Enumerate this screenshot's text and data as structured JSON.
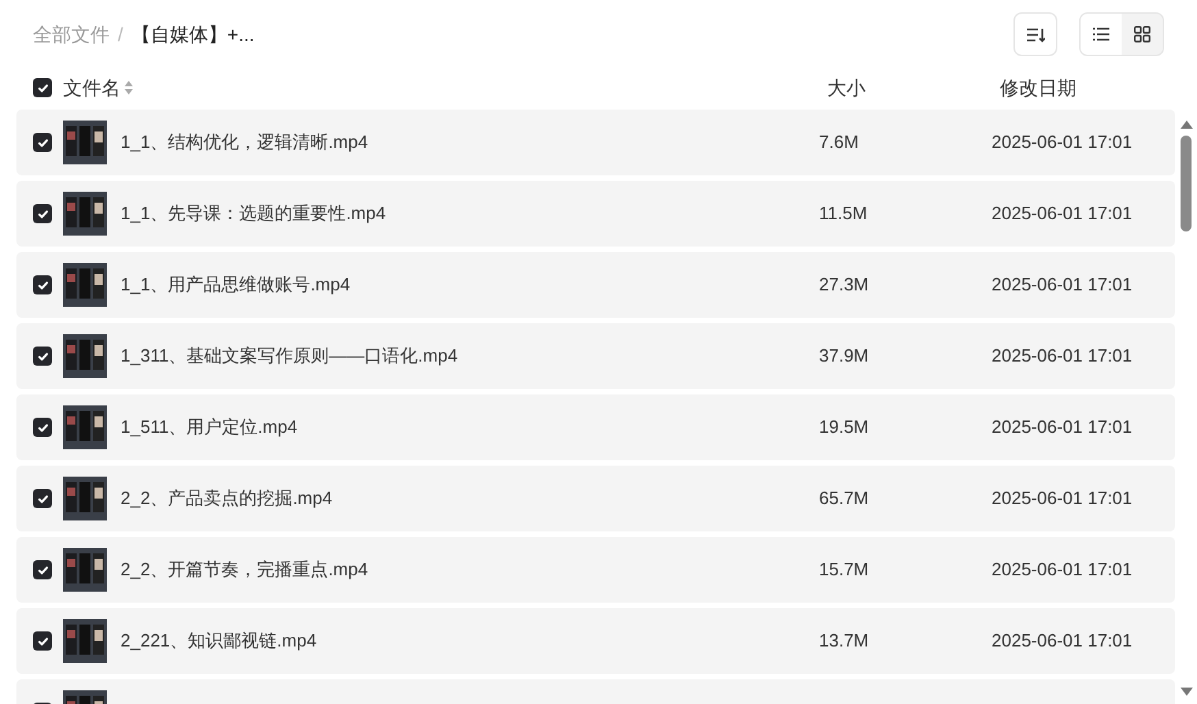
{
  "breadcrumb": [
    {
      "label": "全部文件",
      "current": false
    },
    {
      "label": "【自媒体】+...",
      "current": true
    }
  ],
  "breadcrumb_separator": "/",
  "view_toggle": [
    {
      "kind": "list",
      "selected": true
    },
    {
      "kind": "grid",
      "selected": false
    }
  ],
  "header": {
    "checked": true,
    "columns": [
      "文件名",
      "大小",
      "修改日期"
    ]
  },
  "rows": [
    {
      "checked": true,
      "name": "1_1、结构优化，逻辑清晰.mp4",
      "size": "7.6M",
      "date": "2025-06-01 17:01"
    },
    {
      "checked": true,
      "name": "1_1、先导课：选题的重要性.mp4",
      "size": "11.5M",
      "date": "2025-06-01 17:01"
    },
    {
      "checked": true,
      "name": "1_1、用产品思维做账号.mp4",
      "size": "27.3M",
      "date": "2025-06-01 17:01"
    },
    {
      "checked": true,
      "name": "1_311、基础文案写作原则——口语化.mp4",
      "size": "37.9M",
      "date": "2025-06-01 17:01"
    },
    {
      "checked": true,
      "name": "1_511、用户定位.mp4",
      "size": "19.5M",
      "date": "2025-06-01 17:01"
    },
    {
      "checked": true,
      "name": "2_2、产品卖点的挖掘.mp4",
      "size": "65.7M",
      "date": "2025-06-01 17:01"
    },
    {
      "checked": true,
      "name": "2_2、开篇节奏，完播重点.mp4",
      "size": "15.7M",
      "date": "2025-06-01 17:01"
    },
    {
      "checked": true,
      "name": "2_221、知识鄙视链.mp4",
      "size": "13.7M",
      "date": "2025-06-01 17:01"
    },
    {
      "checked": true
    }
  ]
}
